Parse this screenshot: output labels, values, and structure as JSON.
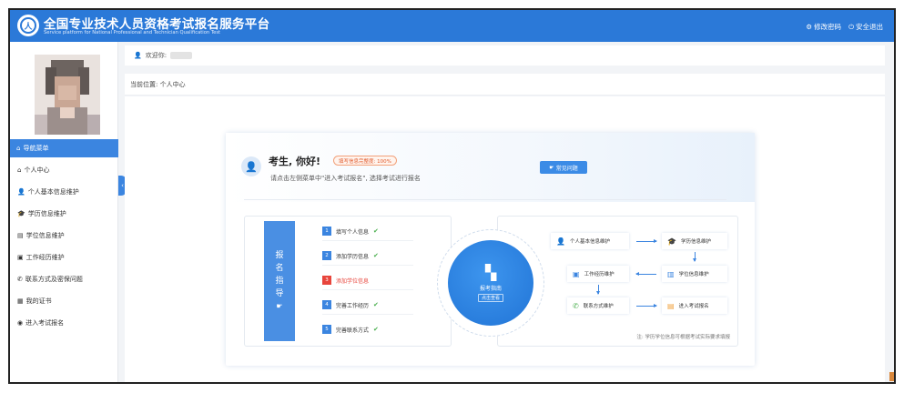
{
  "header": {
    "title_cn": "全国专业技术人员资格考试报名服务平台",
    "title_en": "Service platform for National Professional and Technician Qualification Test",
    "links": [
      {
        "icon": "gear-icon",
        "label": "修改密码"
      },
      {
        "icon": "power-icon",
        "label": "安全退出"
      }
    ]
  },
  "sidebar": {
    "nav_head": "导航菜单",
    "items": [
      {
        "icon": "home-icon",
        "label": "个人中心"
      },
      {
        "icon": "user-icon",
        "label": "个人基本信息维护"
      },
      {
        "icon": "cap-icon",
        "label": "学历信息维护"
      },
      {
        "icon": "book-icon",
        "label": "学位信息维护"
      },
      {
        "icon": "briefcase-icon",
        "label": "工作经历维护"
      },
      {
        "icon": "phone-icon",
        "label": "联系方式及密保问题"
      },
      {
        "icon": "certificate-icon",
        "label": "我的证书"
      },
      {
        "icon": "target-icon",
        "label": "进入考试报名"
      }
    ]
  },
  "topbar": {
    "welcome_label": "欢迎你:",
    "breadcrumb": "当前位置: 个人中心"
  },
  "card": {
    "greeting": "考生, 你好!",
    "progress_badge": "填写信息完整度: 100%",
    "hint": "请点击左侧菜单中\"进入考试报名\", 选择考试进行报名",
    "faq_button": "常见问题",
    "guide_vertical": [
      "报",
      "名",
      "指",
      "导"
    ],
    "steps": [
      {
        "num": "1",
        "label": "填写个人信息",
        "done": true
      },
      {
        "num": "2",
        "label": "添加学历信息",
        "done": true
      },
      {
        "num": "3",
        "label": "添加学位信息",
        "done": false
      },
      {
        "num": "4",
        "label": "完善工作经历",
        "done": true
      },
      {
        "num": "5",
        "label": "完善联系方式",
        "done": true
      }
    ],
    "circle_title": "报考指南",
    "circle_sub": "点击查看",
    "flow": {
      "basic_info": "个人基本信息维护",
      "edu_info": "学历信息维护",
      "work": "工作经历维护",
      "degree_info": "学位信息维护",
      "contact": "联系方式维护",
      "enter_exam": "进入考试报名"
    },
    "note": "注: 学历学位信息可根据考试实际要求填报"
  },
  "colors": {
    "brand": "#2b79d8",
    "nav_active": "#3b85e0",
    "warning": "#e8453c",
    "success": "#4cb050"
  }
}
